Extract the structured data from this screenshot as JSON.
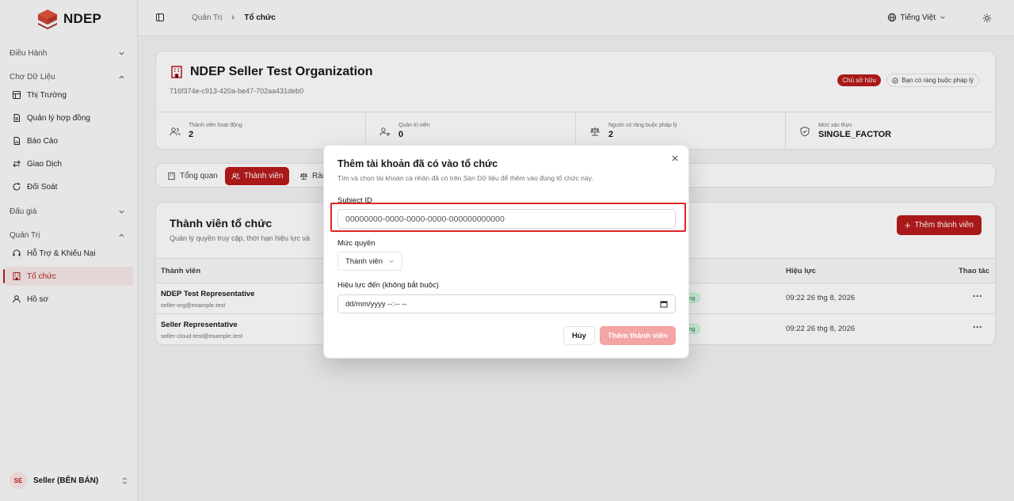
{
  "app": {
    "brand": "NDEP"
  },
  "sidebar": {
    "groups": [
      {
        "label": "Điều Hành",
        "chevron": "chevron-down-icon"
      },
      {
        "label": "Chợ Dữ Liệu",
        "chevron": "chevron-up-icon"
      },
      {
        "label": "Đấu giá",
        "chevron": "chevron-down-icon"
      },
      {
        "label": "Quản Trị",
        "chevron": "chevron-up-icon"
      }
    ],
    "items": [
      {
        "label": "Thị Trường",
        "icon": "grid-doc-icon"
      },
      {
        "label": "Quản lý hợp đồng",
        "icon": "document-icon"
      },
      {
        "label": "Báo Cáo",
        "icon": "report-icon"
      },
      {
        "label": "Giao Dịch",
        "icon": "swap-icon"
      },
      {
        "label": "Đối Soát",
        "icon": "refresh-icon"
      },
      {
        "label": "Hỗ Trợ & Khiếu Nại",
        "icon": "headset-icon"
      },
      {
        "label": "Tổ chức",
        "icon": "building-icon",
        "active": true
      },
      {
        "label": "Hồ sơ",
        "icon": "user-icon"
      }
    ],
    "user": {
      "initials": "SE",
      "name": "Seller (BÊN BÁN)"
    }
  },
  "topbar": {
    "breadcrumb": [
      "Quản Trị",
      "Tổ chức"
    ],
    "language": "Tiếng Việt"
  },
  "org": {
    "name": "NDEP Seller Test Organization",
    "id": "716f374e-c913-420a-be47-702aa431deb0",
    "owner_badge": "Chủ sở hữu",
    "legal_badge": "Bạn có ràng buộc pháp lý",
    "stats": [
      {
        "label": "Thành viên hoạt động",
        "value": "2"
      },
      {
        "label": "Quản trị viên",
        "value": "0"
      },
      {
        "label": "Người có ràng buộc pháp lý",
        "value": "2"
      },
      {
        "label": "Mức xác thực",
        "value": "SINGLE_FACTOR"
      }
    ]
  },
  "tabs": [
    "Tổng quan",
    "Thành viên",
    "Ràn"
  ],
  "members": {
    "title": "Thành viên tổ chức",
    "subtitle": "Quản lý quyền truy cập, thời hạn hiệu lực và",
    "add_label": "Thêm thành viên",
    "columns": {
      "member": "Thành viên",
      "validity": "Hiệu lực",
      "actions": "Thao tác"
    },
    "rows": [
      {
        "name": "NDEP Test Representative",
        "email": "seller-org@example.test",
        "status": "ộng",
        "validity": "09:22 26 thg 8, 2026"
      },
      {
        "name": "Seller Representative",
        "email": "seller-cloud-test@example.test",
        "status": "ộng",
        "validity": "09:22 26 thg 8, 2026"
      }
    ]
  },
  "modal": {
    "title": "Thêm tài khoản đã có vào tổ chức",
    "description": "Tìm và chọn tài khoản cá nhân đã có trên Sàn Dữ liệu để thêm vào đúng tổ chức này.",
    "subject_label": "Subject ID",
    "subject_placeholder": "00000000-0000-0000-0000-000000000000",
    "level_label": "Mức quyền",
    "level_value": "Thành viên",
    "validity_label": "Hiệu lực đến (không bắt buộc)",
    "validity_placeholder": "dd/mm/yyyy --:-- --",
    "cancel_label": "Hủy",
    "submit_label": "Thêm thành viên"
  }
}
